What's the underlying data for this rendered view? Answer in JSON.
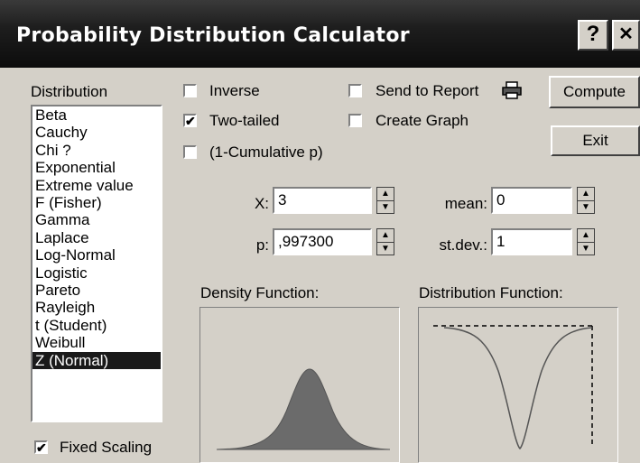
{
  "window": {
    "title": "Probability Distribution Calculator",
    "help_label": "?",
    "close_label": "✕"
  },
  "distribution": {
    "label": "Distribution",
    "items": [
      "Beta",
      "Cauchy",
      "Chi ?",
      "Exponential",
      "Extreme value",
      "F (Fisher)",
      "Gamma",
      "Laplace",
      "Log-Normal",
      "Logistic",
      "Pareto",
      "Rayleigh",
      "t (Student)",
      "Weibull",
      "Z (Normal)"
    ],
    "selected": "Z (Normal)"
  },
  "options": {
    "inverse": {
      "label": "Inverse",
      "checked": false
    },
    "two_tailed": {
      "label": "Two-tailed",
      "checked": true
    },
    "one_minus": {
      "label": "(1-Cumulative p)",
      "checked": false
    },
    "send_report": {
      "label": "Send to Report",
      "checked": false
    },
    "create_graph": {
      "label": "Create Graph",
      "checked": false
    },
    "fixed_scaling": {
      "label": "Fixed Scaling",
      "checked": true
    }
  },
  "buttons": {
    "compute": "Compute",
    "exit": "Exit"
  },
  "params": {
    "x": {
      "label": "X:",
      "value": "3"
    },
    "p": {
      "label": "p:",
      "value": ",997300"
    },
    "mean": {
      "label": "mean:",
      "value": "0"
    },
    "stdev": {
      "label": "st.dev.:",
      "value": "1"
    }
  },
  "graphs": {
    "density_label": "Density Function:",
    "distribution_label": "Distribution Function:"
  },
  "colors": {
    "titlebar": "#1e1e1e",
    "window": "#d4d0c8",
    "curve_fill": "#6b6b6b",
    "selection": "#1a1a1a"
  }
}
